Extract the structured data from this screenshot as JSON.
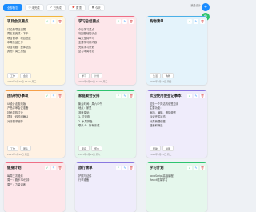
{
  "toolbar": {
    "buttons": [
      {
        "label": "全部备忘"
      },
      {
        "label": "未完成"
      },
      {
        "label": "已完成"
      },
      {
        "label": "置顶"
      },
      {
        "label": "今天"
      }
    ],
    "right_text": "我是设计"
  },
  "cards": [
    {
      "title": "项目会议要点",
      "lines": [
        "讨论新项目进展",
        "周五前完成：下午",
        "项目需求：项目进度",
        "本周总结工作",
        "项目问题：整体总结",
        "其他：周三总结"
      ],
      "tags": [
        "工作",
        "会议"
      ],
      "date": "2025年3月26日 15:00 周三",
      "accent": "#f2b640",
      "bg": "#fff6df"
    },
    {
      "title": "学习总结要点",
      "lines": [
        "今后学习重点",
        "巩固基础知识点",
        "每天坚持学习",
        "主要学习新内容",
        "完成学习计划",
        "复习本周笔记"
      ],
      "tags": [
        "学习",
        "计划"
      ],
      "date": "2025年3月26日 18:00 周三",
      "accent": "#ef6f86",
      "bg": "#fde6ea"
    },
    {
      "title": "购物清单",
      "lines": [],
      "tags": [
        "生活",
        "购物"
      ],
      "date": "2025年3月27日 周四",
      "accent": "#4ab0e8",
      "bg": "#e4f3fb"
    },
    {
      "title": "团队待办事项",
      "lines": [
        "UI设计走查改版",
        "产品评审会议准备",
        "技术架构讨论",
        "项目上线时间确认",
        "对接需求细节"
      ],
      "tags": [
        "工作",
        "团队"
      ],
      "date": "2025年3月28日 周五",
      "accent": "#f6a04a",
      "bg": "#fff1e3"
    },
    {
      "title": "家庭聚会安排",
      "lines": [
        "聚会时间：周六中午",
        "地点：家里",
        "准备菜品：",
        "1. 红烧肉",
        "2. 水果拼盘",
        "联系人：所有亲戚"
      ],
      "tags": [
        "家庭",
        "聚会"
      ],
      "date": "2025年3月29日 周六",
      "accent": "#2ec46f",
      "bg": "#e5f7ec"
    },
    {
      "title": "欢迎使用便签记事本",
      "lines": [
        "这是一个简洁的便签应用",
        "主要功能：",
        "添加、编辑、删除便签",
        "标记完成状态",
        "分类管理便签",
        "搜索和筛选"
      ],
      "tags": [
        "帮助",
        "说明"
      ],
      "date": "2025年3月25日 周二",
      "accent": "#8a78e0",
      "bg": "#efecfb"
    },
    {
      "title": "健身计划",
      "lines": [
        "每周三次锻炼",
        "周一：跑步30分钟",
        "周三：力量训练"
      ],
      "tags": [],
      "date": "",
      "accent": "#ef6f86",
      "bg": "#fde6ea"
    },
    {
      "title": "旅行清单",
      "lines": [
        "护照与证件",
        "行李准备"
      ],
      "tags": [],
      "date": "",
      "accent": "#8a78e0",
      "bg": "#efecfb"
    },
    {
      "title": "学习计划",
      "lines": [
        "JavaScript高级编程",
        "React框架学习"
      ],
      "tags": [],
      "date": "",
      "accent": "#2ec46f",
      "bg": "#e5f7ec"
    }
  ]
}
